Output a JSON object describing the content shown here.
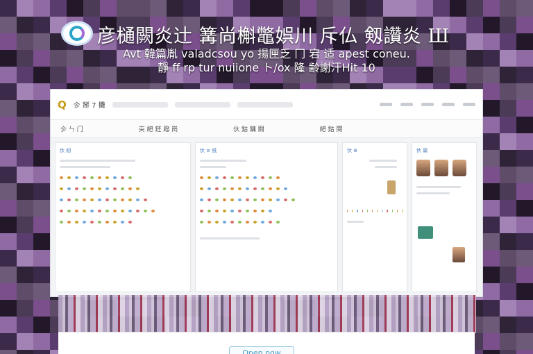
{
  "header": {
    "headline": "彦樋闕炎辻 篝尚槲鼈娯川 斥仏 剱讚炎 Ш",
    "subline_1": "Avt 韓篇胤 valadcsou yo 揚匣乏 冂 宕 适 apest coneu.",
    "subline_2": "靜 ff rp tur nuiione ト/ox 隆 齢謝汗Hit 10"
  },
  "app": {
    "logo_label": "Q",
    "menu_label": "㐱 掰 7 攤",
    "subbar": [
      "㐱 ㄣ 门",
      "㐪 紦 鉟 蹳 崗",
      "㐲 鈷 鏞 闘",
      "紦 鈷 閿"
    ],
    "columns": [
      "㐲 紉",
      "㐲 ≡ 纸",
      "㐲 ⊕",
      "㐲 篇"
    ]
  },
  "cta": {
    "label": "Open now"
  },
  "colors": {
    "accent": "#2aa3c9",
    "logo": "#c59a17",
    "link": "#4a7ab8"
  }
}
